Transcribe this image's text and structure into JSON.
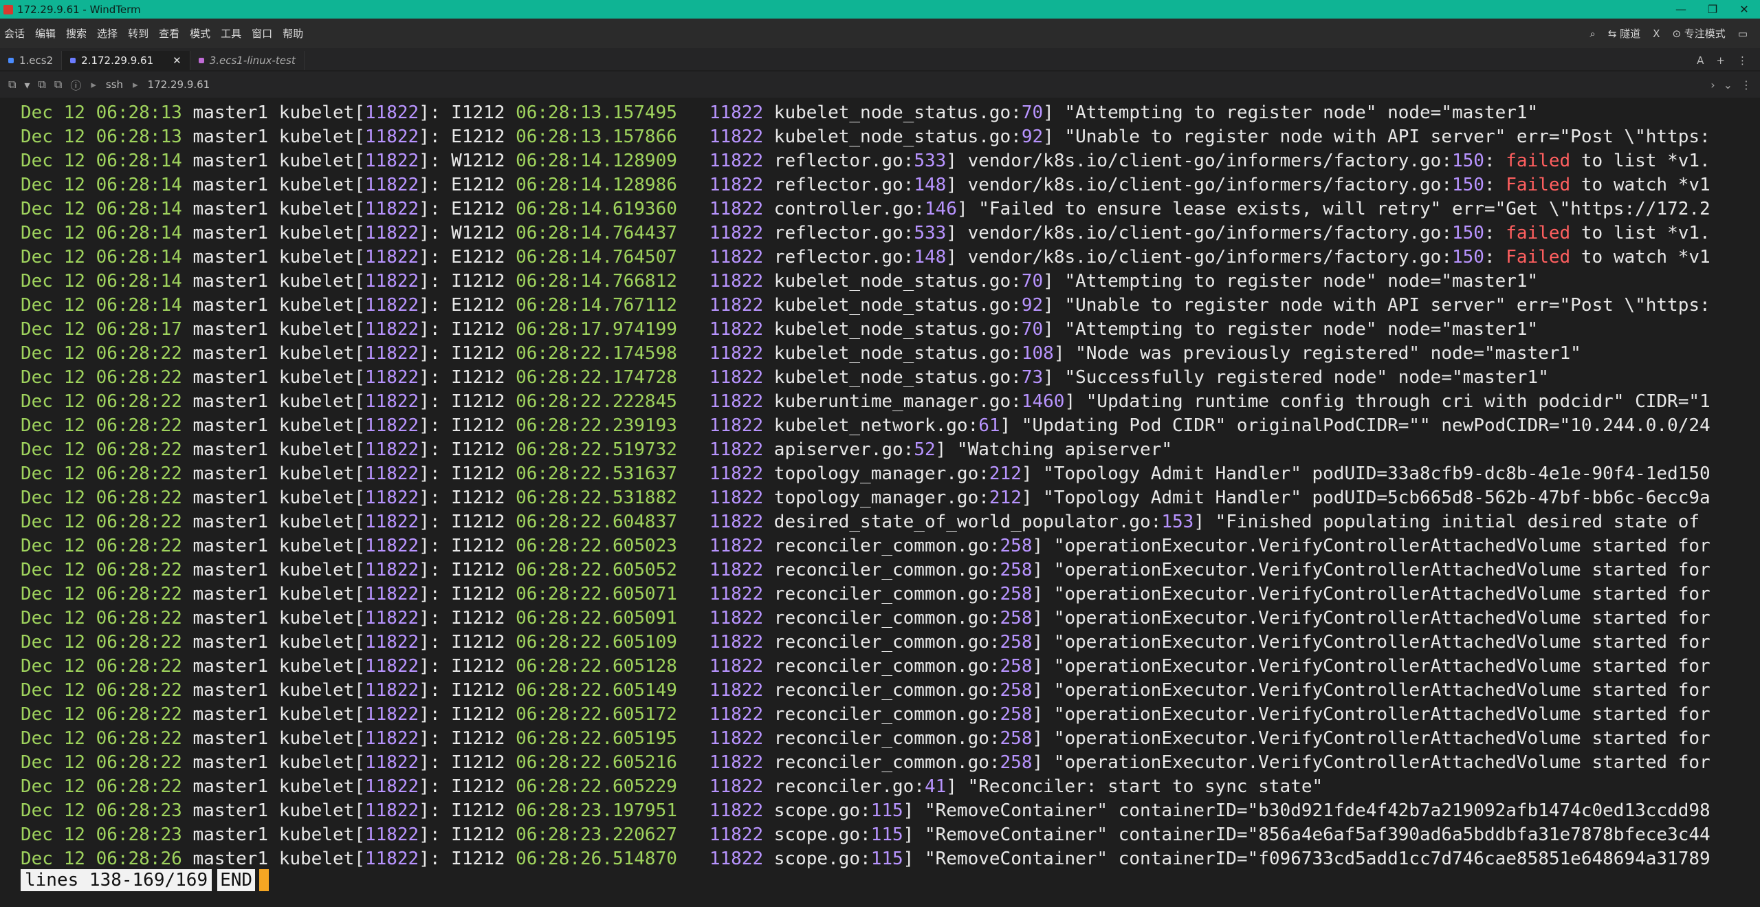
{
  "window": {
    "title": "172.29.9.61 - WindTerm"
  },
  "menu": [
    "会话",
    "编辑",
    "搜索",
    "选择",
    "转到",
    "查看",
    "模式",
    "工具",
    "窗口",
    "帮助"
  ],
  "menu_right": {
    "tunnel": "隧道",
    "x": "X",
    "focus": "专注模式"
  },
  "tabs": [
    {
      "label": "1.ecs2",
      "color": "#4a8cff"
    },
    {
      "label": "2.172.29.9.61",
      "color": "#6b7cff"
    },
    {
      "label": "3.ecs1-linux-test",
      "color": "#c06bd6"
    }
  ],
  "address": {
    "protocol": "ssh",
    "host": "172.29.9.61"
  },
  "log": [
    [
      "Dec 12 06:28:13",
      "I1212 06:28:13.157495",
      "kubelet_node_status.go",
      "70",
      "\"Attempting to register node\" node=\"master1\""
    ],
    [
      "Dec 12 06:28:13",
      "E1212 06:28:13.157866",
      "kubelet_node_status.go",
      "92",
      "\"Unable to register node with API server\" err=\"Post \\\"https:"
    ],
    [
      "Dec 12 06:28:14",
      "W1212 06:28:14.128909",
      "reflector.go",
      "533",
      "vendor/k8s.io/client-go/informers/factory.go:150: failed to list *v1."
    ],
    [
      "Dec 12 06:28:14",
      "E1212 06:28:14.128986",
      "reflector.go",
      "148",
      "vendor/k8s.io/client-go/informers/factory.go:150: Failed to watch *v1"
    ],
    [
      "Dec 12 06:28:14",
      "E1212 06:28:14.619360",
      "controller.go",
      "146",
      "\"Failed to ensure lease exists, will retry\" err=\"Get \\\"https://172.2"
    ],
    [
      "Dec 12 06:28:14",
      "W1212 06:28:14.764437",
      "reflector.go",
      "533",
      "vendor/k8s.io/client-go/informers/factory.go:150: failed to list *v1."
    ],
    [
      "Dec 12 06:28:14",
      "E1212 06:28:14.764507",
      "reflector.go",
      "148",
      "vendor/k8s.io/client-go/informers/factory.go:150: Failed to watch *v1"
    ],
    [
      "Dec 12 06:28:14",
      "I1212 06:28:14.766812",
      "kubelet_node_status.go",
      "70",
      "\"Attempting to register node\" node=\"master1\""
    ],
    [
      "Dec 12 06:28:14",
      "E1212 06:28:14.767112",
      "kubelet_node_status.go",
      "92",
      "\"Unable to register node with API server\" err=\"Post \\\"https:"
    ],
    [
      "Dec 12 06:28:17",
      "I1212 06:28:17.974199",
      "kubelet_node_status.go",
      "70",
      "\"Attempting to register node\" node=\"master1\""
    ],
    [
      "Dec 12 06:28:22",
      "I1212 06:28:22.174598",
      "kubelet_node_status.go",
      "108",
      "\"Node was previously registered\" node=\"master1\""
    ],
    [
      "Dec 12 06:28:22",
      "I1212 06:28:22.174728",
      "kubelet_node_status.go",
      "73",
      "\"Successfully registered node\" node=\"master1\""
    ],
    [
      "Dec 12 06:28:22",
      "I1212 06:28:22.222845",
      "kuberuntime_manager.go",
      "1460",
      "\"Updating runtime config through cri with podcidr\" CIDR=\"1"
    ],
    [
      "Dec 12 06:28:22",
      "I1212 06:28:22.239193",
      "kubelet_network.go",
      "61",
      "\"Updating Pod CIDR\" originalPodCIDR=\"\" newPodCIDR=\"10.244.0.0/24"
    ],
    [
      "Dec 12 06:28:22",
      "I1212 06:28:22.519732",
      "apiserver.go",
      "52",
      "\"Watching apiserver\""
    ],
    [
      "Dec 12 06:28:22",
      "I1212 06:28:22.531637",
      "topology_manager.go",
      "212",
      "\"Topology Admit Handler\" podUID=33a8cfb9-dc8b-4e1e-90f4-1ed150"
    ],
    [
      "Dec 12 06:28:22",
      "I1212 06:28:22.531882",
      "topology_manager.go",
      "212",
      "\"Topology Admit Handler\" podUID=5cb665d8-562b-47bf-bb6c-6ecc9a"
    ],
    [
      "Dec 12 06:28:22",
      "I1212 06:28:22.604837",
      "desired_state_of_world_populator.go",
      "153",
      "\"Finished populating initial desired state of"
    ],
    [
      "Dec 12 06:28:22",
      "I1212 06:28:22.605023",
      "reconciler_common.go",
      "258",
      "\"operationExecutor.VerifyControllerAttachedVolume started for"
    ],
    [
      "Dec 12 06:28:22",
      "I1212 06:28:22.605052",
      "reconciler_common.go",
      "258",
      "\"operationExecutor.VerifyControllerAttachedVolume started for"
    ],
    [
      "Dec 12 06:28:22",
      "I1212 06:28:22.605071",
      "reconciler_common.go",
      "258",
      "\"operationExecutor.VerifyControllerAttachedVolume started for"
    ],
    [
      "Dec 12 06:28:22",
      "I1212 06:28:22.605091",
      "reconciler_common.go",
      "258",
      "\"operationExecutor.VerifyControllerAttachedVolume started for"
    ],
    [
      "Dec 12 06:28:22",
      "I1212 06:28:22.605109",
      "reconciler_common.go",
      "258",
      "\"operationExecutor.VerifyControllerAttachedVolume started for"
    ],
    [
      "Dec 12 06:28:22",
      "I1212 06:28:22.605128",
      "reconciler_common.go",
      "258",
      "\"operationExecutor.VerifyControllerAttachedVolume started for"
    ],
    [
      "Dec 12 06:28:22",
      "I1212 06:28:22.605149",
      "reconciler_common.go",
      "258",
      "\"operationExecutor.VerifyControllerAttachedVolume started for"
    ],
    [
      "Dec 12 06:28:22",
      "I1212 06:28:22.605172",
      "reconciler_common.go",
      "258",
      "\"operationExecutor.VerifyControllerAttachedVolume started for"
    ],
    [
      "Dec 12 06:28:22",
      "I1212 06:28:22.605195",
      "reconciler_common.go",
      "258",
      "\"operationExecutor.VerifyControllerAttachedVolume started for"
    ],
    [
      "Dec 12 06:28:22",
      "I1212 06:28:22.605216",
      "reconciler_common.go",
      "258",
      "\"operationExecutor.VerifyControllerAttachedVolume started for"
    ],
    [
      "Dec 12 06:28:22",
      "I1212 06:28:22.605229",
      "reconciler.go",
      "41",
      "\"Reconciler: start to sync state\""
    ],
    [
      "Dec 12 06:28:23",
      "I1212 06:28:23.197951",
      "scope.go",
      "115",
      "\"RemoveContainer\" containerID=\"b30d921fde4f42b7a219092afb1474c0ed13ccdd98"
    ],
    [
      "Dec 12 06:28:23",
      "I1212 06:28:23.220627",
      "scope.go",
      "115",
      "\"RemoveContainer\" containerID=\"856a4e6af5af390ad6a5bddbfa31e7878bfece3c44"
    ],
    [
      "Dec 12 06:28:26",
      "I1212 06:28:26.514870",
      "scope.go",
      "115",
      "\"RemoveContainer\" containerID=\"f096733cd5add1cc7d746cae85851e648694a31789"
    ]
  ],
  "log_common": {
    "host": "master1",
    "proc": "kubelet",
    "pid": "11822",
    "tid": "11822"
  },
  "status": {
    "lines": "lines 138-169/169",
    "end": "END"
  }
}
